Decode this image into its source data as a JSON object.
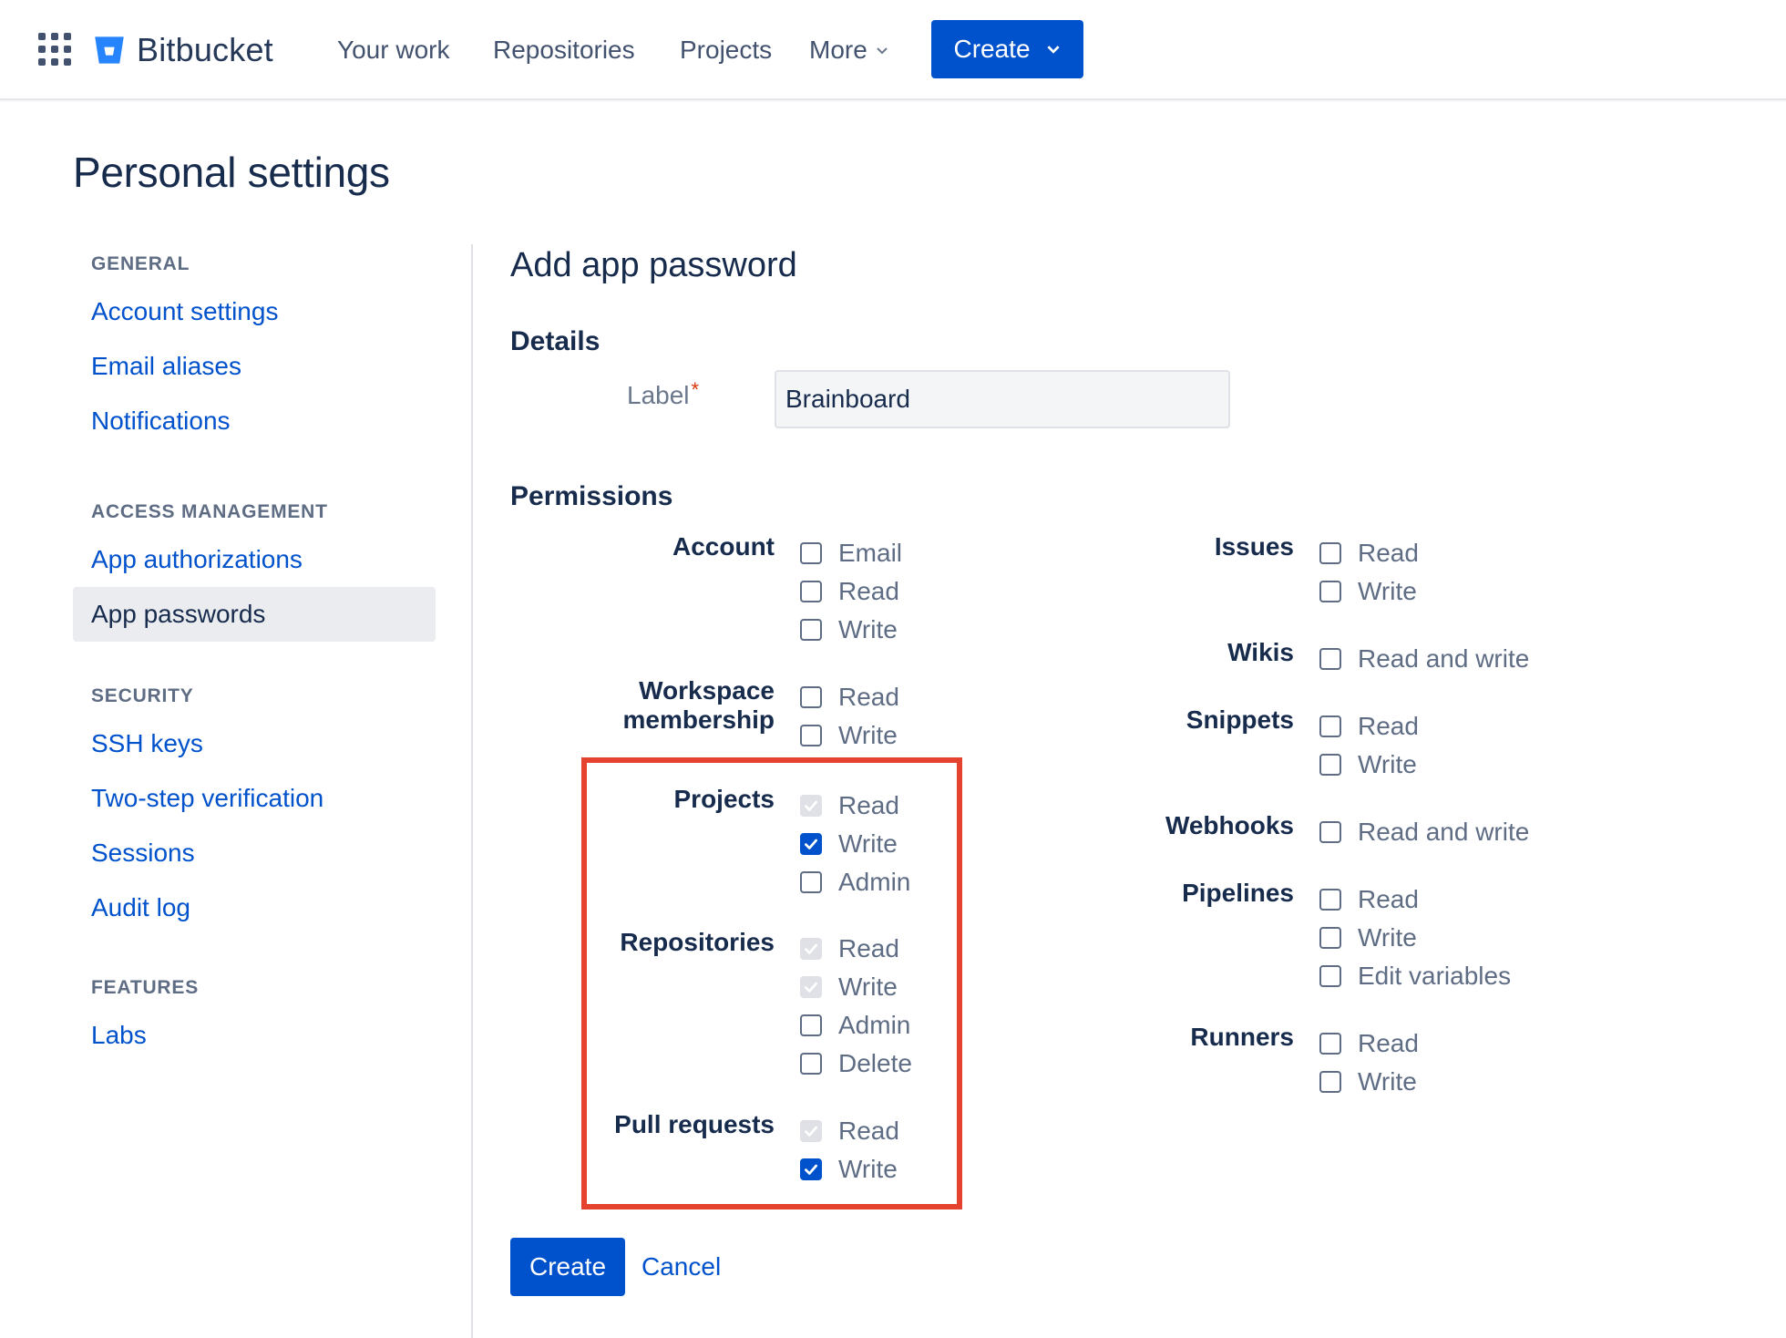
{
  "header": {
    "app_name": "Bitbucket",
    "nav": [
      "Your work",
      "Repositories",
      "Projects",
      "More"
    ],
    "create_label": "Create"
  },
  "page": {
    "title": "Personal settings"
  },
  "sidebar": {
    "sections": [
      {
        "heading": "GENERAL",
        "items": [
          "Account settings",
          "Email aliases",
          "Notifications"
        ]
      },
      {
        "heading": "ACCESS MANAGEMENT",
        "items": [
          "App authorizations",
          "App passwords"
        ]
      },
      {
        "heading": "SECURITY",
        "items": [
          "SSH keys",
          "Two-step verification",
          "Sessions",
          "Audit log"
        ]
      },
      {
        "heading": "FEATURES",
        "items": [
          "Labs"
        ]
      }
    ],
    "active_item": "App passwords"
  },
  "form": {
    "title": "Add app password",
    "details_heading": "Details",
    "label_field": {
      "label": "Label",
      "required_mark": "*",
      "value": "Brainboard"
    },
    "permissions_heading": "Permissions",
    "permissions_left": [
      {
        "name": "Account",
        "options": [
          {
            "label": "Email",
            "state": "unchecked"
          },
          {
            "label": "Read",
            "state": "unchecked"
          },
          {
            "label": "Write",
            "state": "unchecked"
          }
        ]
      },
      {
        "name": "Workspace membership",
        "name_lines": [
          "Workspace",
          "membership"
        ],
        "options": [
          {
            "label": "Read",
            "state": "unchecked"
          },
          {
            "label": "Write",
            "state": "unchecked"
          }
        ]
      },
      {
        "name": "Projects",
        "options": [
          {
            "label": "Read",
            "state": "disabled-checked"
          },
          {
            "label": "Write",
            "state": "checked"
          },
          {
            "label": "Admin",
            "state": "unchecked"
          }
        ]
      },
      {
        "name": "Repositories",
        "options": [
          {
            "label": "Read",
            "state": "disabled-checked"
          },
          {
            "label": "Write",
            "state": "disabled-checked"
          },
          {
            "label": "Admin",
            "state": "unchecked"
          },
          {
            "label": "Delete",
            "state": "unchecked"
          }
        ]
      },
      {
        "name": "Pull requests",
        "options": [
          {
            "label": "Read",
            "state": "disabled-checked"
          },
          {
            "label": "Write",
            "state": "checked"
          }
        ]
      }
    ],
    "permissions_right": [
      {
        "name": "Issues",
        "options": [
          {
            "label": "Read",
            "state": "unchecked"
          },
          {
            "label": "Write",
            "state": "unchecked"
          }
        ]
      },
      {
        "name": "Wikis",
        "options": [
          {
            "label": "Read and write",
            "state": "unchecked"
          }
        ]
      },
      {
        "name": "Snippets",
        "options": [
          {
            "label": "Read",
            "state": "unchecked"
          },
          {
            "label": "Write",
            "state": "unchecked"
          }
        ]
      },
      {
        "name": "Webhooks",
        "options": [
          {
            "label": "Read and write",
            "state": "unchecked"
          }
        ]
      },
      {
        "name": "Pipelines",
        "options": [
          {
            "label": "Read",
            "state": "unchecked"
          },
          {
            "label": "Write",
            "state": "unchecked"
          },
          {
            "label": "Edit variables",
            "state": "unchecked"
          }
        ]
      },
      {
        "name": "Runners",
        "options": [
          {
            "label": "Read",
            "state": "unchecked"
          },
          {
            "label": "Write",
            "state": "unchecked"
          }
        ]
      }
    ],
    "create_label": "Create",
    "cancel_label": "Cancel"
  },
  "colors": {
    "brand": "#0052CC",
    "highlight_border": "#E5432F",
    "text": "#172B4D",
    "muted": "#5E6C84"
  }
}
